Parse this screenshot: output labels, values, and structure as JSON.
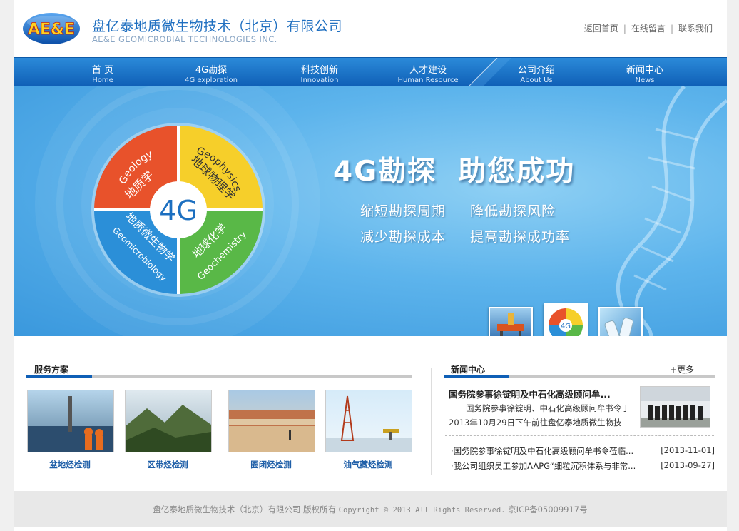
{
  "header": {
    "logo_text": "AE&E",
    "company_cn": "盘亿泰地质微生物技术（北京）有限公司",
    "company_en": "AE&E GEOMICROBIAL TECHNOLOGIES INC.",
    "links": [
      "返回首页",
      "在线留言",
      "联系我们"
    ],
    "separator": "|"
  },
  "nav": {
    "items": [
      {
        "cn": "首 页",
        "en": "Home"
      },
      {
        "cn": "4G勘探",
        "en": "4G exploration"
      },
      {
        "cn": "科技创新",
        "en": "Innovation"
      },
      {
        "cn": "人才建设",
        "en": "Human Resource"
      },
      {
        "cn": "公司介绍",
        "en": "About Us"
      },
      {
        "cn": "新闻中心",
        "en": "News"
      }
    ]
  },
  "banner": {
    "wheel_center": "4G",
    "wheel": [
      {
        "en": "Geology",
        "cn": "地质学",
        "color": "#e8522b"
      },
      {
        "en": "Geophysics",
        "cn": "地球物理学",
        "color": "#f6cf2a"
      },
      {
        "en": "Geochemistry",
        "cn": "地球化学",
        "color": "#59b847"
      },
      {
        "en": "Geomicrobiology",
        "cn": "地质微生物学",
        "color": "#2b8fd8"
      }
    ],
    "slogan_left": "4G勘探",
    "slogan_right": "助您成功",
    "sub_lines": [
      "缩短勘探周期",
      "降低勘探风险",
      "减少勘探成本",
      "提高勘探成功率"
    ],
    "thumb_center_text": "4G"
  },
  "services": {
    "title": "服务方案",
    "items": [
      "盆地烃检测",
      "区带烃检测",
      "圈闭烃检测",
      "油气藏烃检测"
    ]
  },
  "news": {
    "title": "新闻中心",
    "more": "+更多",
    "featured_title": "国务院参事徐锭明及中石化高级顾问牟...",
    "featured_summary": "国务院参事徐锭明、中石化高级顾问牟书令于2013年10月29日下午前往盘亿泰地质微生物技",
    "list": [
      {
        "title": "·国务院参事徐锭明及中石化高级顾问牟书令莅临...",
        "date": "[2013-11-01]"
      },
      {
        "title": "·我公司组织员工参加AAPG“细粒沉积体系与非常...",
        "date": "[2013-09-27]"
      }
    ]
  },
  "footer": {
    "text_cn": "盘亿泰地质微生物技术（北京）有限公司 版权所有",
    "text_copyright": "Copyright © 2013 All Rights Reserved.",
    "text_icp": "京ICP备05009917号"
  },
  "colors": {
    "brand_blue": "#1f6fc0",
    "nav_blue": "#0f5fb6"
  }
}
